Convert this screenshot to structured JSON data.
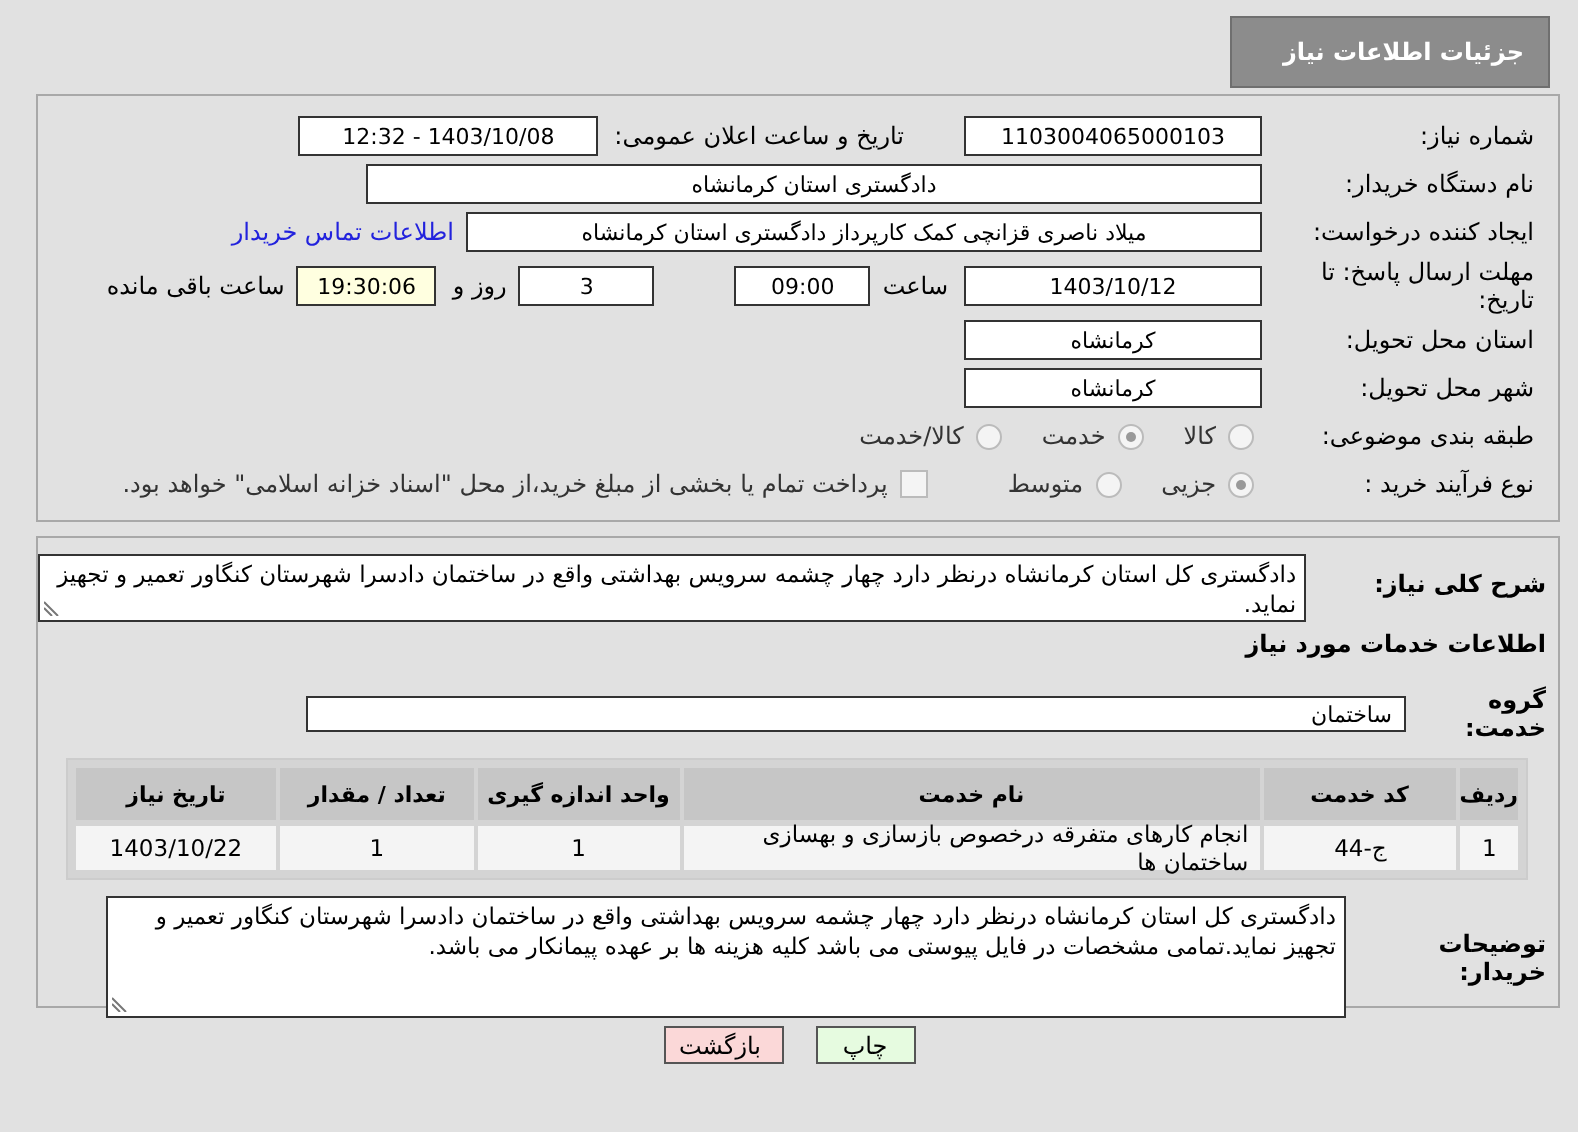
{
  "header": {
    "title": "جزئیات اطلاعات نیاز"
  },
  "rows": [
    {
      "label": "شماره نیاز:",
      "items": [
        {
          "kind": "field",
          "value": "1103004065000103"
        },
        {
          "kind": "text",
          "text": "تاریخ و ساعت اعلان عمومی:"
        },
        {
          "kind": "field",
          "value": "1403/10/08 - 12:32"
        }
      ]
    },
    {
      "label": "نام دستگاه خریدار:",
      "items": [
        {
          "kind": "field",
          "value": "دادگستری استان کرمانشاه"
        }
      ]
    },
    {
      "label": "ایجاد کننده درخواست:",
      "items": [
        {
          "kind": "field",
          "value": "میلاد ناصری قزانچی کمک کارپرداز دادگستری استان کرمانشاه"
        },
        {
          "kind": "link",
          "text": "اطلاعات تماس خریدار"
        }
      ]
    },
    {
      "label": "مهلت ارسال پاسخ: تا تاریخ:",
      "items": [
        {
          "kind": "field",
          "value": "1403/10/12"
        },
        {
          "kind": "text",
          "text": "ساعت"
        },
        {
          "kind": "field",
          "value": "09:00"
        },
        {
          "kind": "field",
          "value": "3"
        },
        {
          "kind": "text",
          "text": "روز و"
        },
        {
          "kind": "timer",
          "value": "19:30:06"
        },
        {
          "kind": "text",
          "text": "ساعت باقی مانده"
        }
      ]
    },
    {
      "label": "استان محل تحویل:",
      "items": [
        {
          "kind": "field",
          "value": "کرمانشاه"
        }
      ]
    },
    {
      "label": "شهر محل تحویل:",
      "items": [
        {
          "kind": "field",
          "value": "کرمانشاه"
        }
      ]
    },
    {
      "label": "طبقه بندی موضوعی:",
      "items": [
        {
          "kind": "radio",
          "text": "کالا",
          "selected": false
        },
        {
          "kind": "radio",
          "text": "خدمت",
          "selected": true
        },
        {
          "kind": "radio",
          "text": "کالا/خدمت",
          "selected": false
        }
      ]
    },
    {
      "label": "نوع فرآیند خرید :",
      "items": [
        {
          "kind": "radio",
          "text": "جزیی",
          "selected": true
        },
        {
          "kind": "radio",
          "text": "متوسط",
          "selected": false
        },
        {
          "kind": "checkbox",
          "text": "پرداخت تمام یا بخشی از مبلغ خرید،از محل \"اسناد خزانه اسلامی\" خواهد بود.",
          "checked": false
        }
      ]
    }
  ],
  "summary": {
    "label": "شرح کلی نیاز:",
    "value": "دادگستری کل استان کرمانشاه درنظر دارد چهار چشمه سرویس بهداشتی واقع در ساختمان دادسرا شهرستان کنگاور  تعمیر و تجهیز نماید."
  },
  "services_heading": "اطلاعات خدمات مورد نیاز",
  "service_group": {
    "label": "گروه خدمت:",
    "value": "ساختمان"
  },
  "table": {
    "columns": [
      "ردیف",
      "کد خدمت",
      "نام خدمت",
      "واحد اندازه گیری",
      "تعداد / مقدار",
      "تاریخ نیاز"
    ],
    "rows": [
      [
        "1",
        "ج-44",
        "انجام کارهای متفرقه درخصوص بازسازی و بهسازی ساختمان ها",
        "1",
        "1",
        "1403/10/22"
      ]
    ]
  },
  "buyer_notes": {
    "label": "توضیحات خریدار:",
    "value": "دادگستری کل استان کرمانشاه درنظر دارد چهار چشمه سرویس بهداشتی واقع در ساختمان دادسرا شهرستان کنگاور  تعمیر و تجهیز نماید.تمامی مشخصات در فایل پیوستی می باشد کلیه هزینه ها بر عهده پیمانکار می باشد."
  },
  "buttons": [
    {
      "kind": "print",
      "label": "چاپ"
    },
    {
      "kind": "back",
      "label": "بازگشت"
    }
  ]
}
